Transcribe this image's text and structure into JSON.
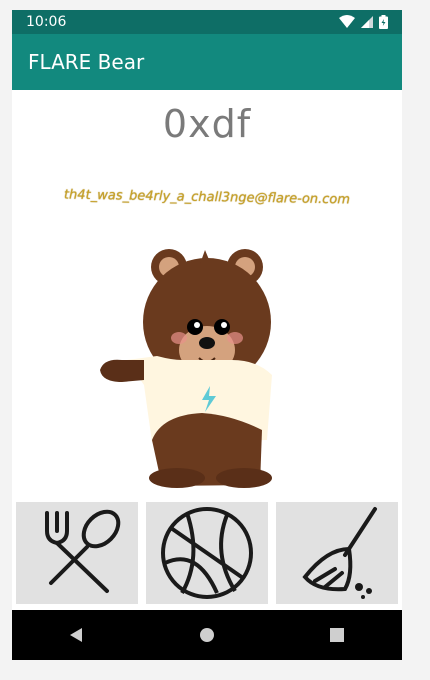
{
  "status_bar": {
    "time": "10:06",
    "icons": [
      "wifi-icon",
      "signal-icon",
      "battery-icon"
    ]
  },
  "app_bar": {
    "title": "FLARE Bear",
    "color": "#12897e"
  },
  "main": {
    "bear_name": "0xdf",
    "flag_text": "th4t_was_be4rly_a_chall3nge@flare-on.com",
    "actions": [
      {
        "name": "feed",
        "icon": "fork-spoon-icon"
      },
      {
        "name": "play",
        "icon": "basketball-icon"
      },
      {
        "name": "clean",
        "icon": "broom-icon"
      }
    ]
  },
  "nav": [
    "back",
    "home",
    "recents"
  ]
}
